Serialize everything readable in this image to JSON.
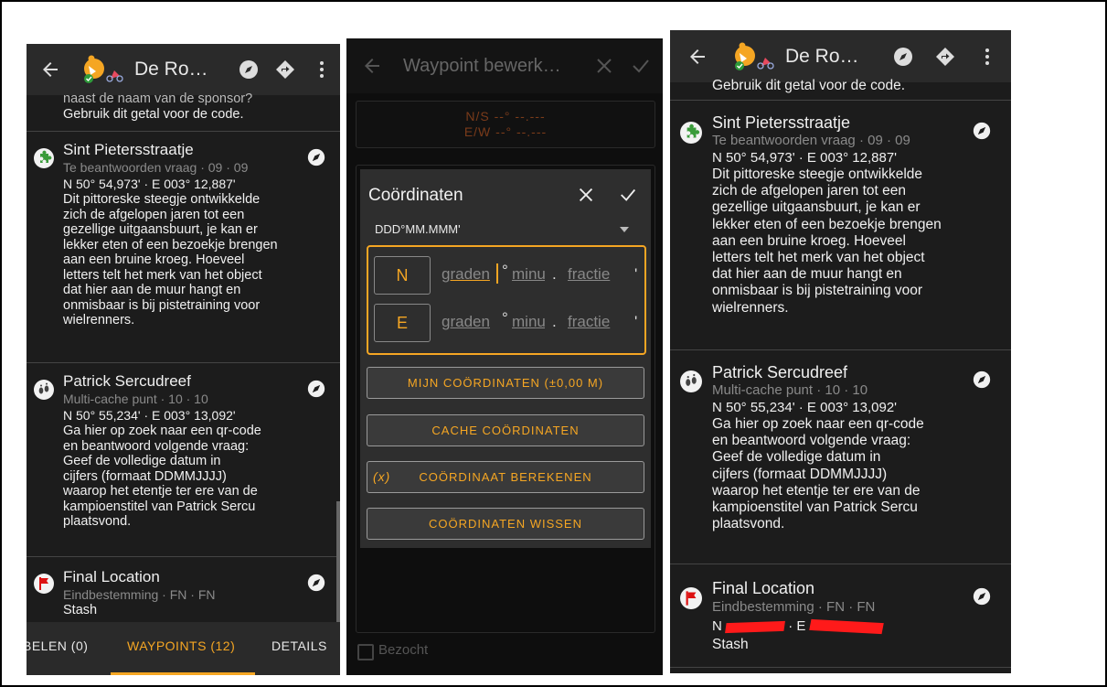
{
  "left_panel": {
    "title": "De Ro…",
    "intro_lines": [
      "naast de naam van de sponsor?",
      "Gebruik dit getal voor de code."
    ],
    "waypoints": [
      {
        "name": "Sint Pietersstraatje",
        "meta": "Te beantwoorden vraag · 09 · 09",
        "coord": "N 50° 54,973' · E 003° 12,887'",
        "desc_lines": [
          "Dit pittoreske steegje ontwikkelde",
          "zich de afgelopen jaren tot een",
          "gezellige uitgaansbuurt, je kan er",
          "lekker eten of een bezoekje brengen",
          "aan een bruine kroeg. Hoeveel",
          "letters telt het merk van het object",
          "dat hier aan de muur hangt en",
          "onmisbaar is bij pistetraining voor",
          "wielrenners."
        ]
      },
      {
        "name": "Patrick Sercudreef",
        "meta": "Multi-cache punt · 10 · 10",
        "coord": "N 50° 55,234' · E 003° 13,092'",
        "desc_lines": [
          "Ga hier op zoek naar een qr-code",
          "en beantwoord volgende vraag:",
          "Geef de volledige datum in",
          "cijfers (formaat DDMMJJJJ)",
          "waarop het etentje ter ere van de",
          "kampioenstitel van Patrick Sercu",
          "plaatsvond."
        ]
      },
      {
        "name": "Final Location",
        "meta": "Eindbestemming · FN · FN",
        "desc_lines": [
          "Stash"
        ]
      }
    ],
    "tabs": [
      "BELEN (0)",
      "WAYPOINTS (12)",
      "DETAILS"
    ]
  },
  "middle_panel": {
    "bg_title": "Waypoint bewerk…",
    "bg_coord_ns": "N/S --° --.---",
    "bg_coord_ew": "E/W --° --.---",
    "bg_checkbox_label": "Bezocht",
    "dialog": {
      "title": "Coördinaten",
      "format": "DDD°MM.MMM'",
      "lat_hemisphere": "N",
      "lon_hemisphere": "E",
      "ph_degrees": "graden",
      "ph_minutes": "minuten",
      "ph_fraction": "fractie",
      "sym_degree": "°",
      "sym_dot": ".",
      "sym_prime": "'",
      "btn_my_coords": "MIJN COÖRDINATEN (±0,00 M)",
      "btn_cache_coords": "CACHE COÖRDINATEN",
      "btn_calc_prefix": "(x)",
      "btn_calc": "COÖRDINAAT BEREKENEN",
      "btn_clear": "COÖRDINATEN WISSEN"
    }
  },
  "right_panel": {
    "title": "De Ro…",
    "intro_line": "Gebruik dit getal voor de code.",
    "waypoints": [
      {
        "name": "Sint Pietersstraatje",
        "meta": "Te beantwoorden vraag · 09 · 09",
        "coord": "N 50° 54,973' · E 003° 12,887'",
        "desc_lines": [
          "Dit pittoreske steegje ontwikkelde",
          "zich de afgelopen jaren tot een",
          "gezellige uitgaansbuurt, je kan er",
          "lekker eten of een bezoekje brengen",
          "aan een bruine kroeg. Hoeveel",
          "letters telt het merk van het object",
          "dat hier aan de muur hangt en",
          "onmisbaar is bij pistetraining voor",
          "wielrenners."
        ]
      },
      {
        "name": "Patrick Sercudreef",
        "meta": "Multi-cache punt · 10 · 10",
        "coord": "N 50° 55,234' · E 003° 13,092'",
        "desc_lines": [
          "Ga hier op zoek naar een qr-code",
          "en beantwoord volgende vraag:",
          "Geef de volledige datum in",
          "cijfers (formaat DDMMJJJJ)",
          "waarop het etentje ter ere van de",
          "kampioenstitel van Patrick Sercu",
          "plaatsvond."
        ]
      },
      {
        "name": "Final Location",
        "meta": "Eindbestemming · FN · FN",
        "coord_n": "N",
        "coord_e": "· E",
        "desc_lines": [
          "Stash"
        ]
      }
    ]
  },
  "colors": {
    "accent": "#f5a623",
    "background": "#1c1c1c",
    "bar": "#2a2a2a",
    "redaction": "#ff1a1a"
  },
  "icons": [
    "back-arrow-icon",
    "geocache-logo-icon",
    "compass-icon",
    "navigate-icon",
    "more-icon",
    "puzzle-icon",
    "footprints-icon",
    "flag-icon",
    "close-icon",
    "check-icon",
    "dropdown-icon"
  ]
}
